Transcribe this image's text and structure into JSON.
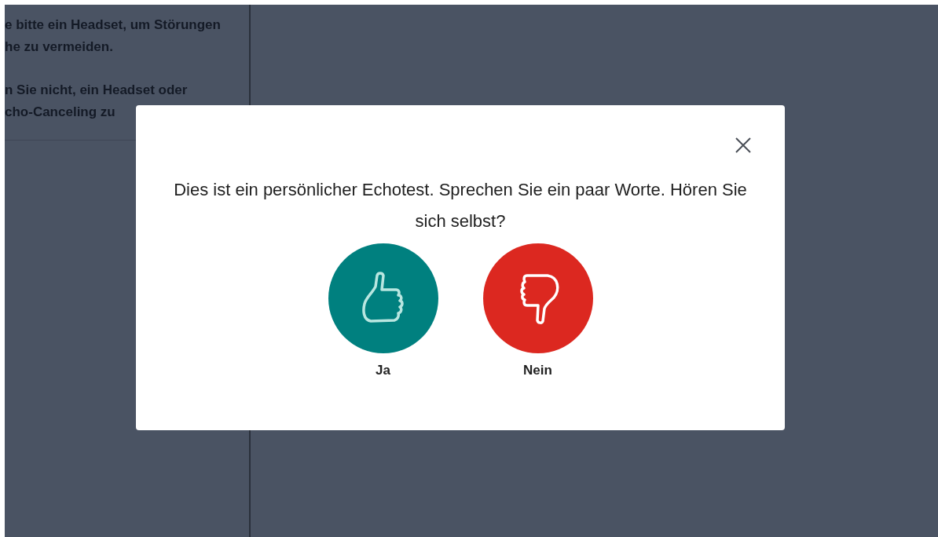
{
  "side_panel": {
    "paragraphs": [
      {
        "lines": [
          "e bitte ein Headset, um Störungen",
          "he zu vermeiden."
        ]
      },
      {
        "lines": [
          "n Sie nicht, ein Headset oder",
          "cho-Canceling zu"
        ]
      }
    ]
  },
  "dialog": {
    "message": "Dies ist ein persönlicher Echotest. Sprechen Sie ein paar Worte. Hören Sie sich selbst?",
    "answers": [
      {
        "kind": "thumbs_up",
        "label": "Ja",
        "color": "#00807f"
      },
      {
        "kind": "thumbs_down",
        "label": "Nein",
        "color": "#dc2820"
      }
    ]
  }
}
